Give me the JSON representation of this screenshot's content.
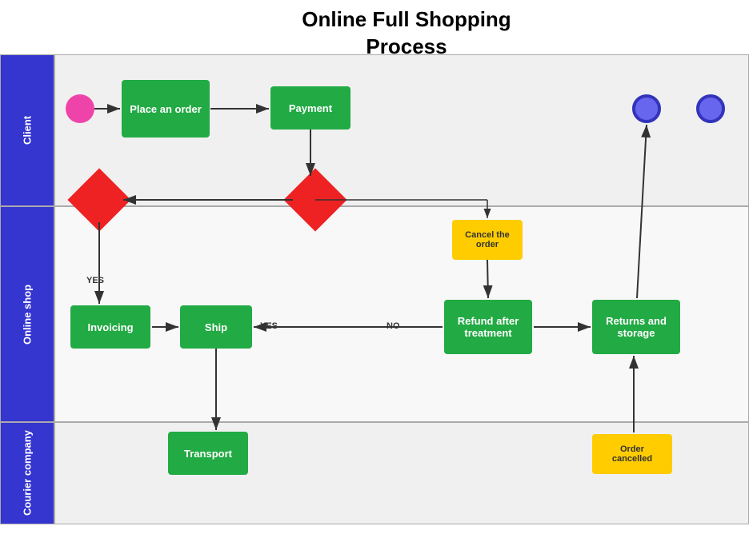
{
  "title": "Online Full Shopping\nProcess",
  "swimlanes": [
    {
      "id": "client",
      "label": "Client"
    },
    {
      "id": "online_shop",
      "label": "Online shop"
    },
    {
      "id": "courier",
      "label": "Courier company"
    }
  ],
  "nodes": {
    "place_order": {
      "label": "Place an\norder"
    },
    "payment": {
      "label": "Payment"
    },
    "invoicing": {
      "label": "Invoicing"
    },
    "ship": {
      "label": "Ship"
    },
    "transport": {
      "label": "Transport"
    },
    "refund": {
      "label": "Refund after\ntreatment"
    },
    "returns": {
      "label": "Returns and\nstorage"
    },
    "cancel_order": {
      "label": "Cancel the\norder"
    },
    "order_cancelled": {
      "label": "Order\ncancelled"
    }
  },
  "labels": {
    "yes1": "YES",
    "yes2": "YES",
    "no": "NO"
  }
}
